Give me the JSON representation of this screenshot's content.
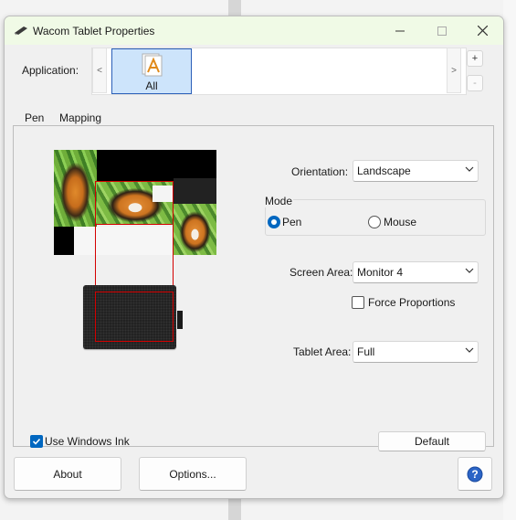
{
  "window": {
    "title": "Wacom Tablet Properties",
    "controls": {
      "minimize_icon": "minimize-icon",
      "maximize_icon": "maximize-icon",
      "close_icon": "close-icon"
    }
  },
  "application": {
    "label": "Application:",
    "prev_arrow": "<",
    "next_arrow": ">",
    "selected_item": "All",
    "add_label": "+",
    "remove_label": "-"
  },
  "tabs": [
    {
      "label": "Pen",
      "active": false
    },
    {
      "label": "Mapping",
      "active": true
    }
  ],
  "mapping": {
    "orientation": {
      "label": "Orientation:",
      "value": "Landscape"
    },
    "mode": {
      "title": "Mode",
      "options": [
        {
          "label": "Pen",
          "selected": true
        },
        {
          "label": "Mouse",
          "selected": false
        }
      ]
    },
    "screen_area": {
      "label": "Screen Area:",
      "value": "Monitor 4"
    },
    "force_proportions": {
      "label": "Force Proportions",
      "checked": false
    },
    "tablet_area": {
      "label": "Tablet Area:",
      "value": "Full"
    },
    "use_windows_ink": {
      "label": "Use Windows Ink",
      "checked": true
    },
    "default_button": "Default"
  },
  "footer": {
    "about_button": "About",
    "options_button": "Options...",
    "help_icon": "help-icon"
  },
  "colors": {
    "accent": "#0067c0",
    "titlebar": "#f0fae6",
    "mapping_box": "#d40000",
    "selected_app_bg": "#cde4fb"
  }
}
